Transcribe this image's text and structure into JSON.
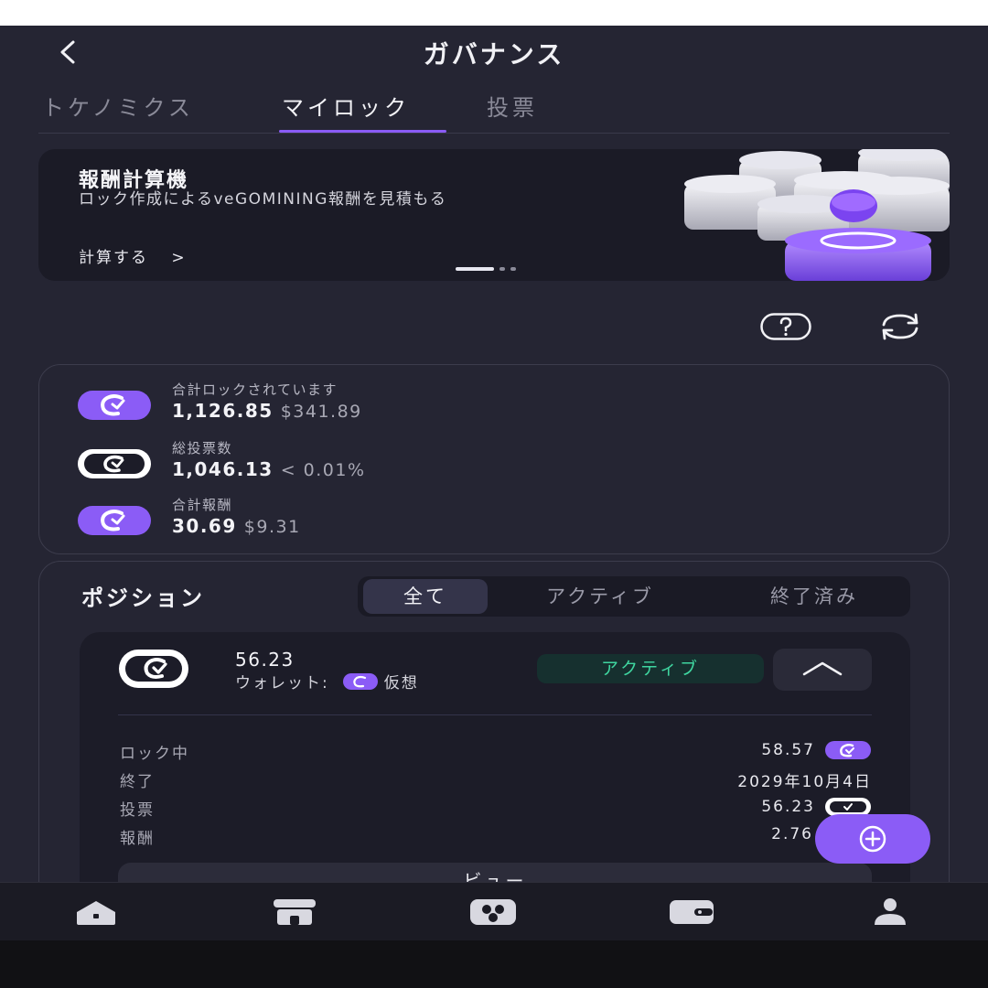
{
  "header": {
    "title": "ガバナンス"
  },
  "tabs": [
    {
      "label": "トケノミクス",
      "active": false
    },
    {
      "label": "マイロック",
      "active": true
    },
    {
      "label": "投票",
      "active": false
    }
  ],
  "banner": {
    "title": "報酬計算機",
    "description": "ロック作成によるveGOMINING報酬を見積もる",
    "cta": "計算する",
    "page_count": 3,
    "active_page": 1
  },
  "stats": {
    "total_locked": {
      "label": "合計ロックされています",
      "value": "1,126.85",
      "sub": "$341.89"
    },
    "total_votes": {
      "label": "総投票数",
      "value": "1,046.13",
      "sub": "< 0.01%"
    },
    "total_rewards": {
      "label": "合計報酬",
      "value": "30.69",
      "sub": "$9.31"
    }
  },
  "positions": {
    "title": "ポジション",
    "filters": [
      {
        "label": "全て",
        "active": true
      },
      {
        "label": "アクティブ",
        "active": false
      },
      {
        "label": "終了済み",
        "active": false
      }
    ],
    "item": {
      "amount": "56.23",
      "wallet_label": "ウォレット:",
      "wallet_name": "仮想",
      "status": "アクティブ",
      "rows": [
        {
          "key": "ロック中",
          "value": "58.57",
          "icon": "gomining-coin-icon"
        },
        {
          "key": "終了",
          "value": "2029年10月4日",
          "icon": ""
        },
        {
          "key": "投票",
          "value": "56.23",
          "icon": "vote-coin-icon"
        },
        {
          "key": "報酬",
          "value": "2.76",
          "icon": "gomining-coin-icon"
        }
      ],
      "view_button": "ビュー"
    }
  },
  "colors": {
    "accent": "#8b5cf6",
    "active_green": "#3fd6a0",
    "background": "#252533"
  },
  "nav": [
    "home-icon",
    "store-icon",
    "mining-icon",
    "wallet-icon",
    "profile-icon"
  ]
}
